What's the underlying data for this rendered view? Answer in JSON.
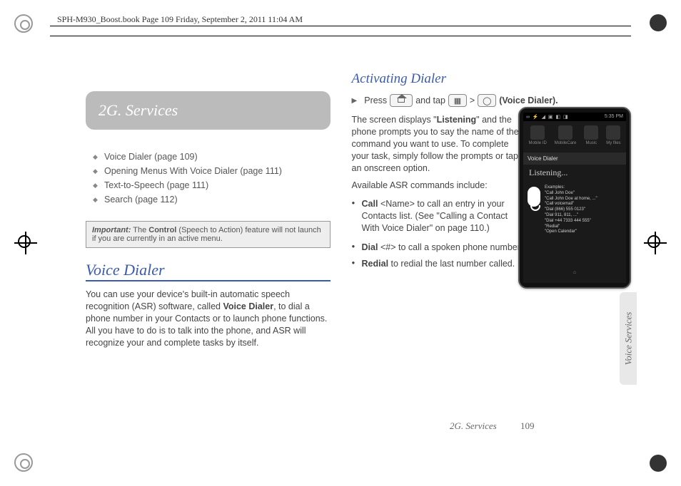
{
  "meta": {
    "header_text": "SPH-M930_Boost.book  Page 109  Friday, September 2, 2011  11:04 AM"
  },
  "chapter": {
    "title": "2G. Services"
  },
  "toc": [
    "Voice Dialer (page 109)",
    "Opening Menus With Voice Dialer (page 111)",
    "Text-to-Speech (page 111)",
    "Search (page 112)"
  ],
  "important": {
    "label": "Important:",
    "text": "The Control (Speech to Action) feature will not launch if you are currently in an active menu."
  },
  "section1": {
    "heading": "Voice Dialer",
    "body": "You can use your device's built-in automatic speech recognition (ASR) software, called Voice Dialer, to dial a phone number in your Contacts or to launch phone functions. All you have to do is to talk into the phone, and ASR will recognize your and complete tasks by itself."
  },
  "section2": {
    "heading": "Activating Dialer",
    "step": {
      "press": "Press",
      "and_tap": "and tap",
      "gt": ">",
      "label": "(Voice Dialer)."
    },
    "para1": "The screen displays \"Listening\" and the phone prompts you to say the name of the command you want to use. To complete your task, simply follow the prompts or tap an onscreen option.",
    "para2": "Available ASR commands include:",
    "cmds": [
      {
        "bold": "Call",
        "rest": " <Name> to call an entry in your Contacts list. (See \"Calling a Contact With Voice Dialer\" on page 110.)"
      },
      {
        "bold": "Dial",
        "rest": " <#> to call a spoken phone number."
      },
      {
        "bold": "Redial",
        "rest": " to redial the last number called."
      }
    ]
  },
  "phone": {
    "time": "5:35 PM",
    "status_icons": "∞ ⚡ ◢ ▣ ◧ ◨",
    "apps": [
      "Mobile ID",
      "MobileCare",
      "Music",
      "My files"
    ],
    "title_bar": "Voice Dialer",
    "listening": "Listening...",
    "examples_label": "Examples:",
    "examples": [
      "\"Call John Doe\"",
      "\"Call John Doe at home, ...\"",
      "\"Call voicemail\"",
      "\"Dial (866) 555 0123\"",
      "\"Dial 911, 811, ...\"",
      "\"Dial +44 7333 444 555\"",
      "\"Redial\"",
      "\"Open Calendar\""
    ]
  },
  "side_tab": "Voice Services",
  "footer": {
    "chapter": "2G. Services",
    "page": "109"
  }
}
